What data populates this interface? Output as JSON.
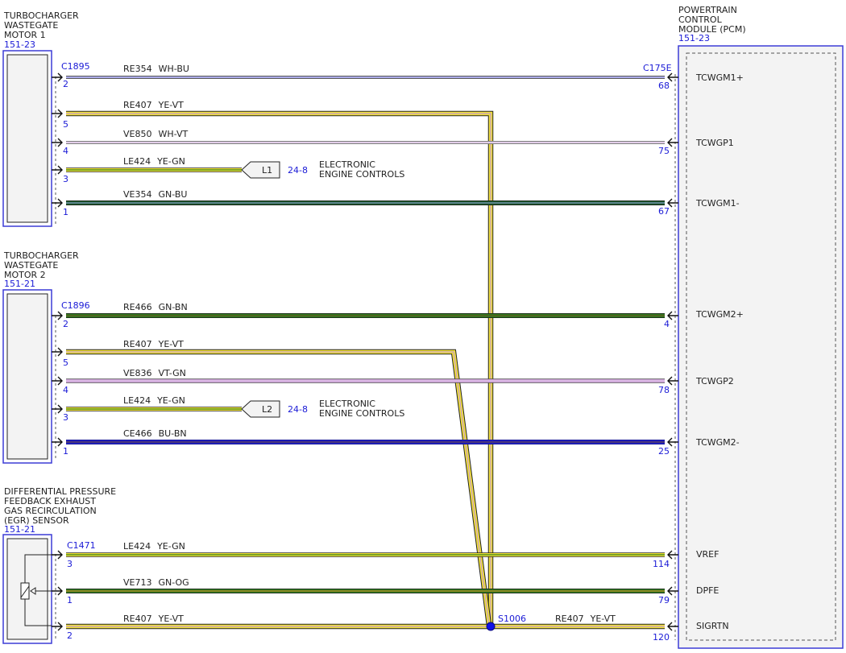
{
  "colors": {
    "connector_blue": "#3c3cd6",
    "text_blue": "#1a1ad6",
    "white": "#ffffff",
    "yellow": "#f2e233",
    "violet": "#c59bd1",
    "light_violet": "#e7c9ee",
    "green": "#2f7d1f",
    "light_green": "#b9dd4a",
    "dark_green": "#1d5a2a",
    "blue": "#2020c8",
    "light_blue": "#9aa8ef",
    "brown": "#6f4a22",
    "orange": "#e38a2a",
    "splice": "#1111e8"
  },
  "components": {
    "tcwg1": {
      "lines": [
        "TURBOCHARGER",
        "WASTEGATE",
        "MOTOR 1"
      ],
      "ref": "151-23",
      "connector": "C1895"
    },
    "tcwg2": {
      "lines": [
        "TURBOCHARGER",
        "WASTEGATE",
        "MOTOR 2"
      ],
      "ref": "151-21",
      "connector": "C1896"
    },
    "dpfe": {
      "lines": [
        "DIFFERENTIAL PRESSURE",
        "FEEDBACK EXHAUST",
        "GAS RECIRCULATION",
        "(EGR) SENSOR"
      ],
      "ref": "151-21",
      "connector": "C1471"
    },
    "pcm": {
      "lines": [
        "POWERTRAIN",
        "CONTROL",
        "MODULE (PCM)"
      ],
      "ref": "151-23",
      "connector": "C175E"
    }
  },
  "wires": [
    {
      "circuit": "RE354",
      "color": "WH-BU",
      "left_pin": "2",
      "right_pin": "68",
      "signal": "TCWGM1+"
    },
    {
      "circuit": "RE407",
      "color": "YE-VT",
      "left_pin": "5"
    },
    {
      "circuit": "VE850",
      "color": "WH-VT",
      "left_pin": "4",
      "right_pin": "75",
      "signal": "TCWGP1"
    },
    {
      "circuit": "LE424",
      "color": "YE-GN",
      "left_pin": "3"
    },
    {
      "circuit": "VE354",
      "color": "GN-BU",
      "left_pin": "1",
      "right_pin": "67",
      "signal": "TCWGM1-"
    },
    {
      "circuit": "RE466",
      "color": "GN-BN",
      "left_pin": "2",
      "right_pin": "4",
      "signal": "TCWGM2+"
    },
    {
      "circuit": "RE407",
      "color": "YE-VT",
      "left_pin": "5"
    },
    {
      "circuit": "VE836",
      "color": "VT-GN",
      "left_pin": "4",
      "right_pin": "78",
      "signal": "TCWGP2"
    },
    {
      "circuit": "LE424",
      "color": "YE-GN",
      "left_pin": "3"
    },
    {
      "circuit": "CE466",
      "color": "BU-BN",
      "left_pin": "1",
      "right_pin": "25",
      "signal": "TCWGM2-"
    },
    {
      "circuit": "LE424",
      "color": "YE-GN",
      "left_pin": "3",
      "right_pin": "114",
      "signal": "VREF"
    },
    {
      "circuit": "VE713",
      "color": "GN-OG",
      "left_pin": "1",
      "right_pin": "79",
      "signal": "DPFE"
    },
    {
      "circuit": "RE407",
      "color": "YE-VT",
      "left_pin": "2",
      "right_pin": "120",
      "signal": "SIGRTN"
    }
  ],
  "splice": {
    "label": "S1006",
    "out_circuit": "RE407",
    "out_color": "YE-VT"
  },
  "references": [
    {
      "tag": "L1",
      "page": "24-8",
      "text": [
        "ELECTRONIC",
        "ENGINE CONTROLS"
      ]
    },
    {
      "tag": "L2",
      "page": "24-8",
      "text": [
        "ELECTRONIC",
        "ENGINE CONTROLS"
      ]
    }
  ]
}
